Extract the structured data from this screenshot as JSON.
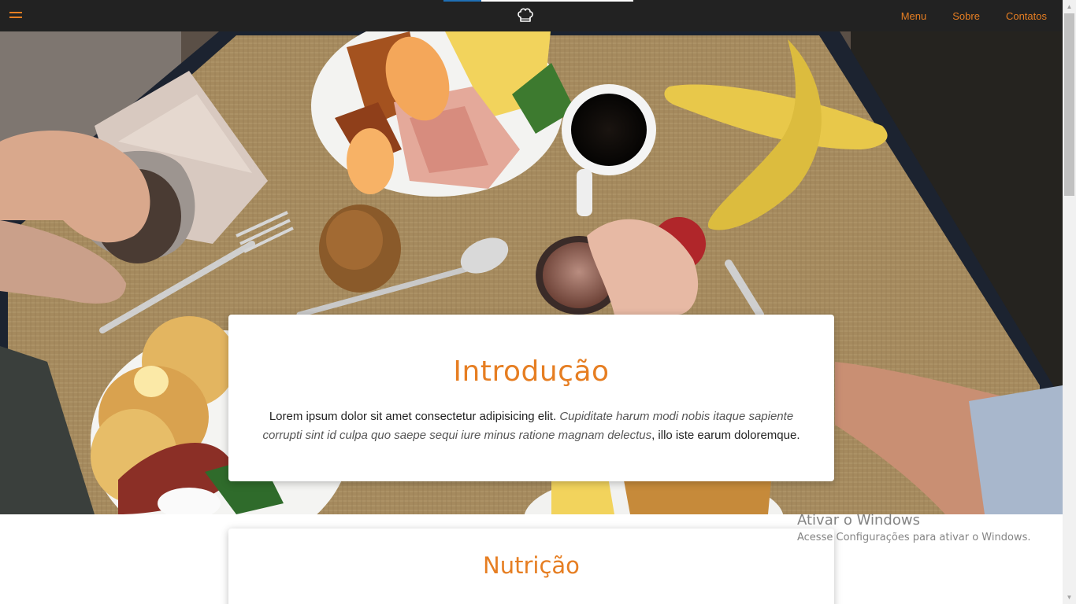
{
  "nav": {
    "links": [
      "Menu",
      "Sobre",
      "Contatos"
    ],
    "accent_color": "#e67e22",
    "bar_color": "#222222",
    "menu_icon": "hamburger-icon",
    "logo_icon": "chef-hat-icon"
  },
  "hero": {
    "image_description_icon": "breakfast-table-photo"
  },
  "intro": {
    "title": "Introdução",
    "text_plain": "Lorem ipsum dolor sit amet consectetur adipisicing elit. ",
    "text_italic": "Cupiditate harum modi nobis itaque sapiente corrupti sint id culpa quo saepe sequi iure minus ratione magnam delectus",
    "text_end": ", illo iste earum doloremque."
  },
  "nutrition": {
    "title": "Nutrição"
  },
  "watermark": {
    "title": "Ativar o Windows",
    "subtitle": "Acesse Configurações para ativar o Windows."
  }
}
